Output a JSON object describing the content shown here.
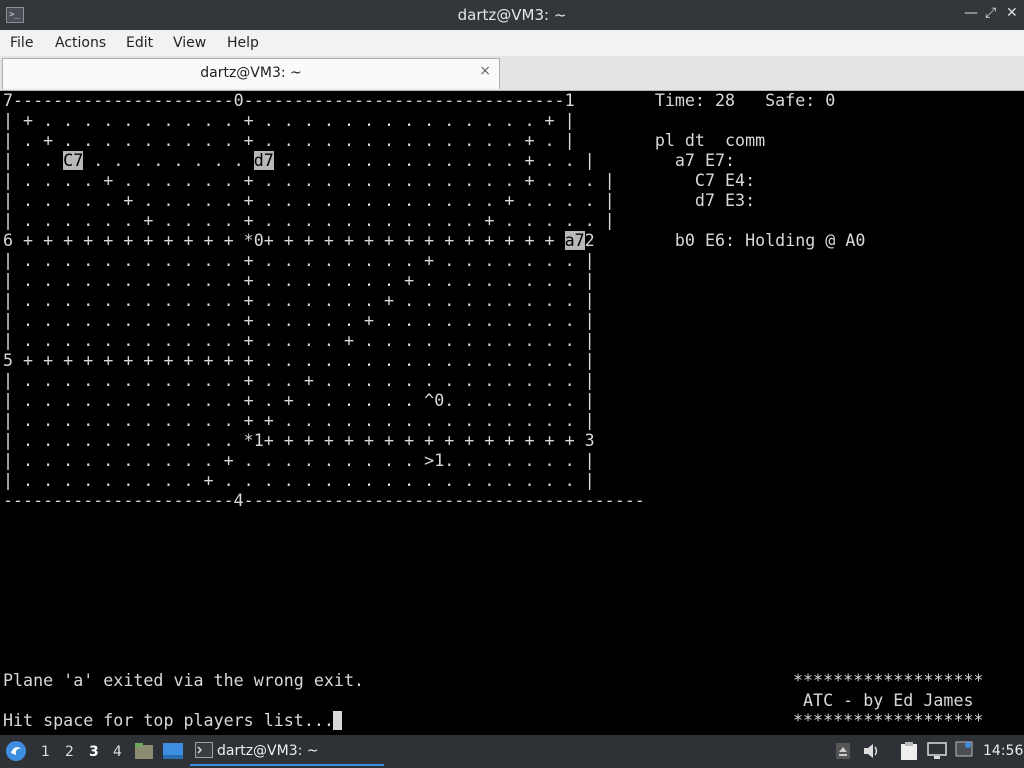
{
  "window": {
    "title": "dartz@VM3: ~",
    "app_icon_glyph": ">_"
  },
  "menubar": {
    "items": [
      "File",
      "Actions",
      "Edit",
      "View",
      "Help"
    ]
  },
  "tab": {
    "label": "dartz@VM3: ~",
    "close_glyph": "×"
  },
  "terminal": {
    "highlight_color": "#b8b8b8",
    "lines": [
      "7----------------------0--------------------------------1        Time: 28   Safe: 0",
      "| + . . . . . . . . . . + . . . . . . . . . . . . . . + |",
      "| . + . . . . . . . . . + . . . . . . . . . . . . . + . |        pl dt  comm",
      "| . . [[C7]] . . . . . . . . [[d7]] . . . . . . . . . . . . + . . |        a7 E7:",
      "| . . . . + . . . . . . + . . . . . . . . . . . . . + . . . |        C7 E4:",
      "| . . . . . + . . . . . + . . . . . . . . . . . . + . . . . |        d7 E3:",
      "| . . . . . . + . . . . + . . . . . . . . . . . + . . . . . |",
      "6 + + + + + + + + + + + *0+ + + + + + + + + + + + + + + [[a7]]2        b0 E6: Holding @ A0",
      "| . . . . . . . . . . . + . . . . . . . . + . . . . . . . |",
      "| . . . . . . . . . . . + . . . . . . . + . . . . . . . . |",
      "| . . . . . . . . . . . + . . . . . . + . . . . . . . . . |",
      "| . . . . . . . . . . . + . . . . . + . . . . . . . . . . |",
      "| . . . . . . . . . . . + . . . . + . . . . . . . . . . . |",
      "5 + + + + + + + + + + + + . . . . . . . . . . . . . . . . |",
      "| . . . . . . . . . . . + . . + . . . . . . . . . . . . . |",
      "| . . . . . . . . . . . + . + . . . . . . ^0. . . . . . . |",
      "| . . . . . . . . . . . + + . . . . . . . . . . . . . . . |",
      "| . . . . . . . . . . . *1+ + + + + + + + + + + + + + + + 3",
      "| . . . . . . . . . . + . . . . . . . . . >1. . . . . . . |",
      "| . . . . . . . . . + . . . . . . . . . . . . . . . . . . |",
      "-----------------------4----------------------------------------",
      "",
      "",
      "",
      "",
      "",
      "",
      "",
      "",
      "Plane 'a' exited via the wrong exit.",
      "",
      "Hit space for top players list..."
    ],
    "side_lines": [
      "*******************",
      " ATC - by Ed James",
      "*******************"
    ]
  },
  "taskbar": {
    "workspaces": [
      "1",
      "2",
      "3",
      "4"
    ],
    "active_workspace": "3",
    "task_label": "dartz@VM3: ~",
    "clock": "14:56",
    "accent": "#3d8ee0"
  }
}
